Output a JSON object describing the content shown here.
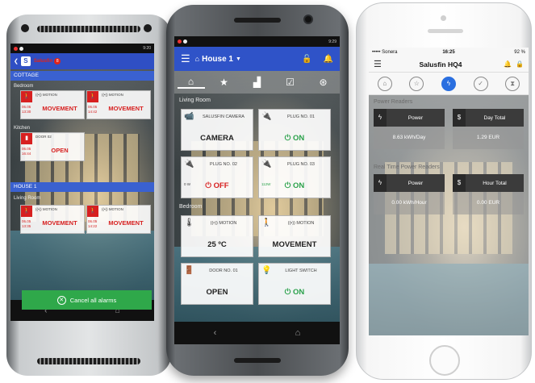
{
  "htc": {
    "statusbar_time": "9:20",
    "app_name": "Salusfin",
    "alarm_badge": "8",
    "sections": [
      {
        "title": "COTTAGE"
      },
      {
        "title": "HOUSE 1"
      }
    ],
    "rooms": [
      "Bedroom",
      "Kitchen",
      "Living Room"
    ],
    "tiles": [
      {
        "header": "((•)) MOTION",
        "date": "06.05",
        "time": "13:30",
        "value": "MOVEMENT"
      },
      {
        "header": "((•)) MOTION",
        "date": "06.05",
        "time": "14:42",
        "value": "MOVEMENT"
      },
      {
        "header": "DOOR 02",
        "date": "06.05",
        "time": "16:44",
        "value": "OPEN"
      },
      {
        "header": "((•)) MOTION",
        "date": "06.05",
        "time": "13:35",
        "value": "MOVEMENT"
      },
      {
        "header": "((•)) MOTION",
        "date": "06.05",
        "time": "14:22",
        "value": "MOVEMENT"
      }
    ],
    "cancel_label": "Cancel all alarms"
  },
  "nexus": {
    "statusbar_time": "9:29",
    "title": "House 1",
    "rooms": [
      "Living Room",
      "Bedroom"
    ],
    "tiles": [
      {
        "header": "SALUSFIN CAMERA",
        "value": "CAMERA",
        "sub": "",
        "state": "normal"
      },
      {
        "header": "PLUG NO. 01",
        "value": "ON",
        "sub": "",
        "state": "on"
      },
      {
        "header": "PLUG NO. 02",
        "value": "OFF",
        "sub": "0 W",
        "state": "off"
      },
      {
        "header": "PLUG NO. 03",
        "value": "ON",
        "sub": "112W",
        "state": "on"
      },
      {
        "header": "((•)) MOTION",
        "value": "25 ºC",
        "sub": "",
        "state": "normal"
      },
      {
        "header": "((•)) MOTION",
        "value": "MOVEMENT",
        "sub": "",
        "state": "normal"
      },
      {
        "header": "DOOR NO. 01",
        "value": "OPEN",
        "sub": "",
        "state": "normal"
      },
      {
        "header": "LIGHT SWITCH",
        "value": "ON",
        "sub": "",
        "state": "on"
      }
    ]
  },
  "iphone": {
    "carrier": "••••• Sonera",
    "time": "16:25",
    "battery": "92 %",
    "title": "Salusfin HQ4",
    "sections": [
      "Power Readers",
      "Real Time Power Readers"
    ],
    "cards": [
      {
        "label": "Power",
        "value": "8.63 kWh/Day"
      },
      {
        "label": "Day Total",
        "value": "1.29 EUR"
      },
      {
        "label": "Power",
        "value": "0.00 kWh/Hour"
      },
      {
        "label": "Hour Total",
        "value": "0.00 EUR"
      }
    ]
  },
  "colors": {
    "brand_blue": "#2f53c8",
    "alarm_red": "#d72020",
    "on_green": "#2aa14a",
    "ios_blue": "#2a6fe0"
  }
}
